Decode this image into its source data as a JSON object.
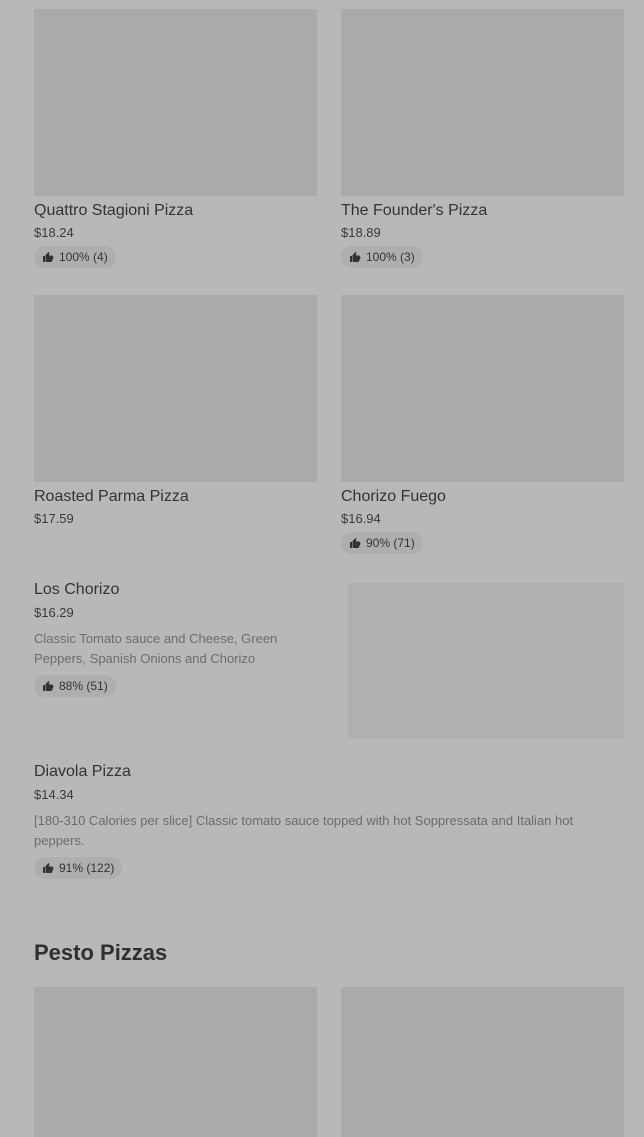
{
  "grid_items": [
    {
      "title": "Quattro Stagioni Pizza",
      "price": "$18.24",
      "rating": "100% (4)"
    },
    {
      "title": "The Founder's Pizza",
      "price": "$18.89",
      "rating": "100% (3)"
    },
    {
      "title": "Roasted Parma Pizza",
      "price": "$17.59",
      "rating": ""
    },
    {
      "title": "Chorizo Fuego",
      "price": "$16.94",
      "rating": "90% (71)"
    }
  ],
  "list_items": [
    {
      "title": "Los Chorizo",
      "price": "$16.29",
      "description": "Classic Tomato sauce and Cheese, Green Peppers, Spanish Onions and Chorizo",
      "rating": "88% (51)"
    },
    {
      "title": "Diavola Pizza",
      "price": "$14.34",
      "description": "[180-310 Calories per slice] Classic tomato sauce topped with hot Soppressata and Italian hot peppers.",
      "rating": "91% (122)"
    }
  ],
  "sections": {
    "pesto_title": "Pesto Pizzas"
  },
  "icons": {
    "rating": "thumbs-up-icon"
  },
  "colors": {
    "background": "#b8b8b8",
    "image_placeholder": "#aaaaaa",
    "badge": "#aeaeae"
  }
}
